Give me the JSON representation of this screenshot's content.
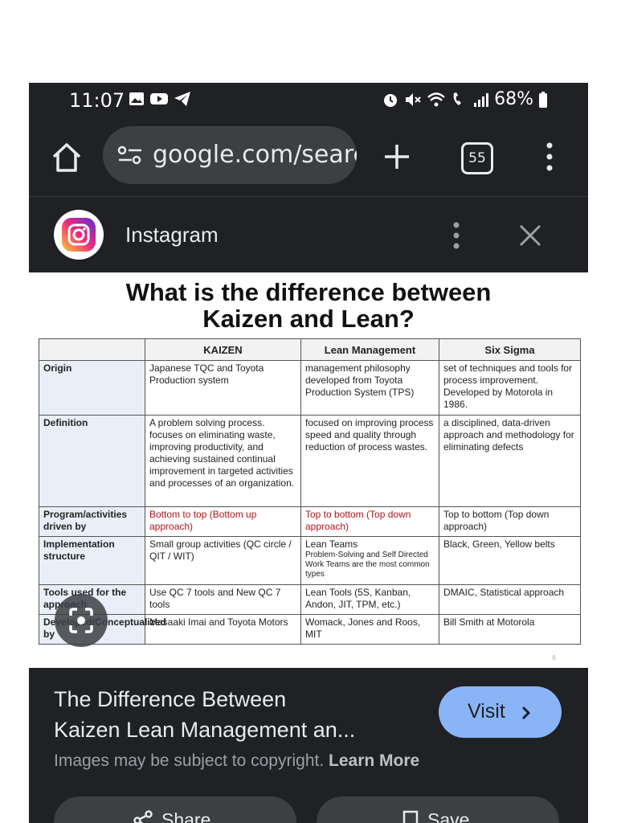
{
  "status_bar": {
    "time": "11:07",
    "battery": "68%",
    "left_icons": [
      "image-icon",
      "youtube-icon",
      "telegram-icon"
    ],
    "right_icons": [
      "alarm-icon",
      "mute-icon",
      "wifi-icon",
      "wifi-calling-icon",
      "signal-icon",
      "battery-icon"
    ]
  },
  "browser": {
    "url": "google.com/search",
    "tab_count": "55"
  },
  "source_bar": {
    "title": "Instagram"
  },
  "image": {
    "title_line1": "What is the difference between",
    "title_line2": "Kaizen and Lean?",
    "page_number": "6",
    "table": {
      "headers": [
        "",
        "KAIZEN",
        "Lean Management",
        "Six Sigma"
      ],
      "rows": [
        {
          "label": "Origin",
          "kaizen": "Japanese TQC and Toyota Production system",
          "lean": "management philosophy developed from Toyota Production System (TPS)",
          "six_sigma": "set of techniques and tools for process improvement. Developed by Motorola in 1986."
        },
        {
          "label": "Definition",
          "kaizen": "A problem solving process. focuses on eliminating waste, improving productivity, and achieving sustained continual improvement in targeted activities and processes of an organization.",
          "lean": "focused on improving process speed and quality through reduction of process wastes.",
          "six_sigma": "a disciplined, data-driven approach and methodology for eliminating defects"
        },
        {
          "label": "Program/activities driven by",
          "kaizen": "Bottom to top (Bottom up approach)",
          "lean": "Top to bottom (Top down approach)",
          "six_sigma": "Top to bottom (Top down approach)"
        },
        {
          "label": "Implementation structure",
          "kaizen": "Small group activities (QC circle / QIT / WIT)",
          "lean": "Lean Teams",
          "lean_note": "Problem-Solving and Self Directed Work Teams are the most common types",
          "six_sigma": "Black, Green, Yellow belts"
        },
        {
          "label": "Tools used for the approach",
          "kaizen": "Use QC 7 tools and New QC 7 tools",
          "lean": "Lean Tools (5S, Kanban, Andon, JIT, TPM, etc.)",
          "six_sigma": "DMAIC, Statistical approach"
        },
        {
          "label": "Developed/Conceptualized by",
          "kaizen": "Masaaki Imai and Toyota Motors",
          "lean": "Womack, Jones and Roos, MIT",
          "six_sigma": "Bill Smith at Motorola"
        }
      ]
    }
  },
  "result": {
    "title_line1": "The Difference Between",
    "title_line2": "Kaizen Lean Management an...",
    "visit_label": "Visit",
    "copyright_text": "Images may be subject to copyright.",
    "learn_more": "Learn More",
    "share_label": "Share",
    "save_label": "Save"
  },
  "colors": {
    "background": "#202124",
    "url_bar": "#3c4043",
    "visit_button": "#8ab4f8",
    "red_text": "#a8181a",
    "row_header": "#e8eff8"
  }
}
